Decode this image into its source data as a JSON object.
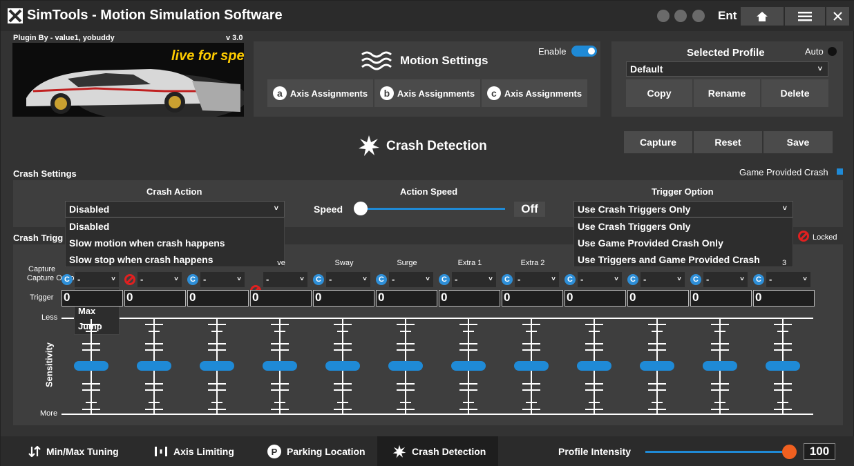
{
  "window": {
    "title": "SimTools - Motion Simulation Software",
    "ent": "Ent",
    "icons": [
      "download-icon",
      "pen-icon",
      "power-icon",
      "home-icon",
      "menu-icon",
      "close-icon"
    ]
  },
  "plugin": {
    "credit": "Plugin By - value1, yobuddy",
    "version": "v 3.0",
    "game_logo_text": "live for speed"
  },
  "motion": {
    "title": "Motion Settings",
    "enable_label": "Enable",
    "enabled": true,
    "axis_buttons": [
      {
        "letter": "a",
        "label": "Axis Assignments"
      },
      {
        "letter": "b",
        "label": "Axis Assignments"
      },
      {
        "letter": "c",
        "label": "Axis Assignments"
      }
    ]
  },
  "profile": {
    "title": "Selected Profile",
    "auto_label": "Auto",
    "selected": "Default",
    "buttons": [
      "Copy",
      "Rename",
      "Delete"
    ]
  },
  "page": {
    "title": "Crash Detection",
    "buttons": [
      "Capture",
      "Reset",
      "Save"
    ]
  },
  "crash_settings": {
    "title": "Crash Settings",
    "game_provided_label": "Game Provided Crash",
    "crash_action": {
      "label": "Crash Action",
      "selected": "Disabled",
      "options": [
        "Disabled",
        "Slow motion when crash happens",
        "Slow stop when crash happens"
      ]
    },
    "action_speed": {
      "label": "Action Speed",
      "speed_label": "Speed",
      "value": "Off",
      "level": 0
    },
    "trigger_option": {
      "label": "Trigger Option",
      "selected": "Use Crash Triggers Only",
      "options": [
        "Use Crash Triggers Only",
        "Use Game Provided Crash Only",
        "Use Triggers and Game Provided Crash"
      ]
    }
  },
  "triggers": {
    "title": "Crash Trigg",
    "locked_label": "Locked",
    "capture_option_label": "Capture Option -",
    "trigger_label": "Trigger",
    "less_label": "Less",
    "more_label": "More",
    "sensitivity_label": "Sensitivity",
    "axes": [
      {
        "name": "",
        "icon": "c",
        "option": "-",
        "value": "0"
      },
      {
        "name": "",
        "icon": "no",
        "option": "-",
        "value": "0"
      },
      {
        "name": "",
        "icon": "c",
        "option": "-",
        "value": "0"
      },
      {
        "name": "ve",
        "icon": "no",
        "option": "-",
        "value": "0"
      },
      {
        "name": "Sway",
        "icon": "c",
        "option": "-",
        "value": "0"
      },
      {
        "name": "Surge",
        "icon": "c",
        "option": "-",
        "value": "0"
      },
      {
        "name": "Extra 1",
        "icon": "c",
        "option": "-",
        "value": "0"
      },
      {
        "name": "Extra 2",
        "icon": "c",
        "option": "-",
        "value": "0"
      },
      {
        "name": "",
        "icon": "c",
        "option": "-",
        "value": "0"
      },
      {
        "name": "",
        "icon": "c",
        "option": "-",
        "value": "0"
      },
      {
        "name": "",
        "icon": "c",
        "option": "-",
        "value": "0"
      },
      {
        "name": "3",
        "icon": "c",
        "option": "-",
        "value": "0"
      }
    ],
    "capture_dropdown_open": [
      "-",
      "Max",
      "Jump"
    ]
  },
  "bottom": {
    "tabs": [
      {
        "label": "Min/Max Tuning",
        "icon": "arrows-icon"
      },
      {
        "label": "Axis Limiting",
        "icon": "bars-icon"
      },
      {
        "label": "Parking Location",
        "icon": "parking-icon"
      },
      {
        "label": "Crash Detection",
        "icon": "crash-icon"
      }
    ],
    "intensity_label": "Profile Intensity",
    "intensity_value": "100"
  },
  "colors": {
    "accent": "#1f8ad6",
    "orange": "#f06020",
    "red": "#e02020"
  }
}
